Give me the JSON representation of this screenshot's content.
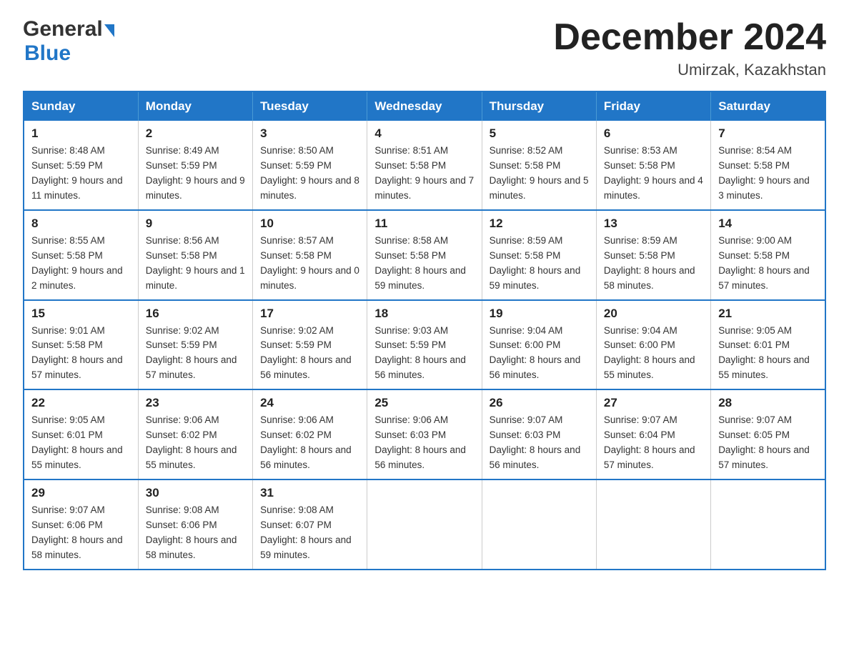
{
  "header": {
    "logo_top": "General",
    "logo_bottom": "Blue",
    "main_title": "December 2024",
    "subtitle": "Umirzak, Kazakhstan"
  },
  "calendar": {
    "columns": [
      "Sunday",
      "Monday",
      "Tuesday",
      "Wednesday",
      "Thursday",
      "Friday",
      "Saturday"
    ],
    "weeks": [
      [
        {
          "day": "1",
          "sunrise": "Sunrise: 8:48 AM",
          "sunset": "Sunset: 5:59 PM",
          "daylight": "Daylight: 9 hours and 11 minutes."
        },
        {
          "day": "2",
          "sunrise": "Sunrise: 8:49 AM",
          "sunset": "Sunset: 5:59 PM",
          "daylight": "Daylight: 9 hours and 9 minutes."
        },
        {
          "day": "3",
          "sunrise": "Sunrise: 8:50 AM",
          "sunset": "Sunset: 5:59 PM",
          "daylight": "Daylight: 9 hours and 8 minutes."
        },
        {
          "day": "4",
          "sunrise": "Sunrise: 8:51 AM",
          "sunset": "Sunset: 5:58 PM",
          "daylight": "Daylight: 9 hours and 7 minutes."
        },
        {
          "day": "5",
          "sunrise": "Sunrise: 8:52 AM",
          "sunset": "Sunset: 5:58 PM",
          "daylight": "Daylight: 9 hours and 5 minutes."
        },
        {
          "day": "6",
          "sunrise": "Sunrise: 8:53 AM",
          "sunset": "Sunset: 5:58 PM",
          "daylight": "Daylight: 9 hours and 4 minutes."
        },
        {
          "day": "7",
          "sunrise": "Sunrise: 8:54 AM",
          "sunset": "Sunset: 5:58 PM",
          "daylight": "Daylight: 9 hours and 3 minutes."
        }
      ],
      [
        {
          "day": "8",
          "sunrise": "Sunrise: 8:55 AM",
          "sunset": "Sunset: 5:58 PM",
          "daylight": "Daylight: 9 hours and 2 minutes."
        },
        {
          "day": "9",
          "sunrise": "Sunrise: 8:56 AM",
          "sunset": "Sunset: 5:58 PM",
          "daylight": "Daylight: 9 hours and 1 minute."
        },
        {
          "day": "10",
          "sunrise": "Sunrise: 8:57 AM",
          "sunset": "Sunset: 5:58 PM",
          "daylight": "Daylight: 9 hours and 0 minutes."
        },
        {
          "day": "11",
          "sunrise": "Sunrise: 8:58 AM",
          "sunset": "Sunset: 5:58 PM",
          "daylight": "Daylight: 8 hours and 59 minutes."
        },
        {
          "day": "12",
          "sunrise": "Sunrise: 8:59 AM",
          "sunset": "Sunset: 5:58 PM",
          "daylight": "Daylight: 8 hours and 59 minutes."
        },
        {
          "day": "13",
          "sunrise": "Sunrise: 8:59 AM",
          "sunset": "Sunset: 5:58 PM",
          "daylight": "Daylight: 8 hours and 58 minutes."
        },
        {
          "day": "14",
          "sunrise": "Sunrise: 9:00 AM",
          "sunset": "Sunset: 5:58 PM",
          "daylight": "Daylight: 8 hours and 57 minutes."
        }
      ],
      [
        {
          "day": "15",
          "sunrise": "Sunrise: 9:01 AM",
          "sunset": "Sunset: 5:58 PM",
          "daylight": "Daylight: 8 hours and 57 minutes."
        },
        {
          "day": "16",
          "sunrise": "Sunrise: 9:02 AM",
          "sunset": "Sunset: 5:59 PM",
          "daylight": "Daylight: 8 hours and 57 minutes."
        },
        {
          "day": "17",
          "sunrise": "Sunrise: 9:02 AM",
          "sunset": "Sunset: 5:59 PM",
          "daylight": "Daylight: 8 hours and 56 minutes."
        },
        {
          "day": "18",
          "sunrise": "Sunrise: 9:03 AM",
          "sunset": "Sunset: 5:59 PM",
          "daylight": "Daylight: 8 hours and 56 minutes."
        },
        {
          "day": "19",
          "sunrise": "Sunrise: 9:04 AM",
          "sunset": "Sunset: 6:00 PM",
          "daylight": "Daylight: 8 hours and 56 minutes."
        },
        {
          "day": "20",
          "sunrise": "Sunrise: 9:04 AM",
          "sunset": "Sunset: 6:00 PM",
          "daylight": "Daylight: 8 hours and 55 minutes."
        },
        {
          "day": "21",
          "sunrise": "Sunrise: 9:05 AM",
          "sunset": "Sunset: 6:01 PM",
          "daylight": "Daylight: 8 hours and 55 minutes."
        }
      ],
      [
        {
          "day": "22",
          "sunrise": "Sunrise: 9:05 AM",
          "sunset": "Sunset: 6:01 PM",
          "daylight": "Daylight: 8 hours and 55 minutes."
        },
        {
          "day": "23",
          "sunrise": "Sunrise: 9:06 AM",
          "sunset": "Sunset: 6:02 PM",
          "daylight": "Daylight: 8 hours and 55 minutes."
        },
        {
          "day": "24",
          "sunrise": "Sunrise: 9:06 AM",
          "sunset": "Sunset: 6:02 PM",
          "daylight": "Daylight: 8 hours and 56 minutes."
        },
        {
          "day": "25",
          "sunrise": "Sunrise: 9:06 AM",
          "sunset": "Sunset: 6:03 PM",
          "daylight": "Daylight: 8 hours and 56 minutes."
        },
        {
          "day": "26",
          "sunrise": "Sunrise: 9:07 AM",
          "sunset": "Sunset: 6:03 PM",
          "daylight": "Daylight: 8 hours and 56 minutes."
        },
        {
          "day": "27",
          "sunrise": "Sunrise: 9:07 AM",
          "sunset": "Sunset: 6:04 PM",
          "daylight": "Daylight: 8 hours and 57 minutes."
        },
        {
          "day": "28",
          "sunrise": "Sunrise: 9:07 AM",
          "sunset": "Sunset: 6:05 PM",
          "daylight": "Daylight: 8 hours and 57 minutes."
        }
      ],
      [
        {
          "day": "29",
          "sunrise": "Sunrise: 9:07 AM",
          "sunset": "Sunset: 6:06 PM",
          "daylight": "Daylight: 8 hours and 58 minutes."
        },
        {
          "day": "30",
          "sunrise": "Sunrise: 9:08 AM",
          "sunset": "Sunset: 6:06 PM",
          "daylight": "Daylight: 8 hours and 58 minutes."
        },
        {
          "day": "31",
          "sunrise": "Sunrise: 9:08 AM",
          "sunset": "Sunset: 6:07 PM",
          "daylight": "Daylight: 8 hours and 59 minutes."
        },
        {
          "day": "",
          "sunrise": "",
          "sunset": "",
          "daylight": ""
        },
        {
          "day": "",
          "sunrise": "",
          "sunset": "",
          "daylight": ""
        },
        {
          "day": "",
          "sunrise": "",
          "sunset": "",
          "daylight": ""
        },
        {
          "day": "",
          "sunrise": "",
          "sunset": "",
          "daylight": ""
        }
      ]
    ]
  }
}
